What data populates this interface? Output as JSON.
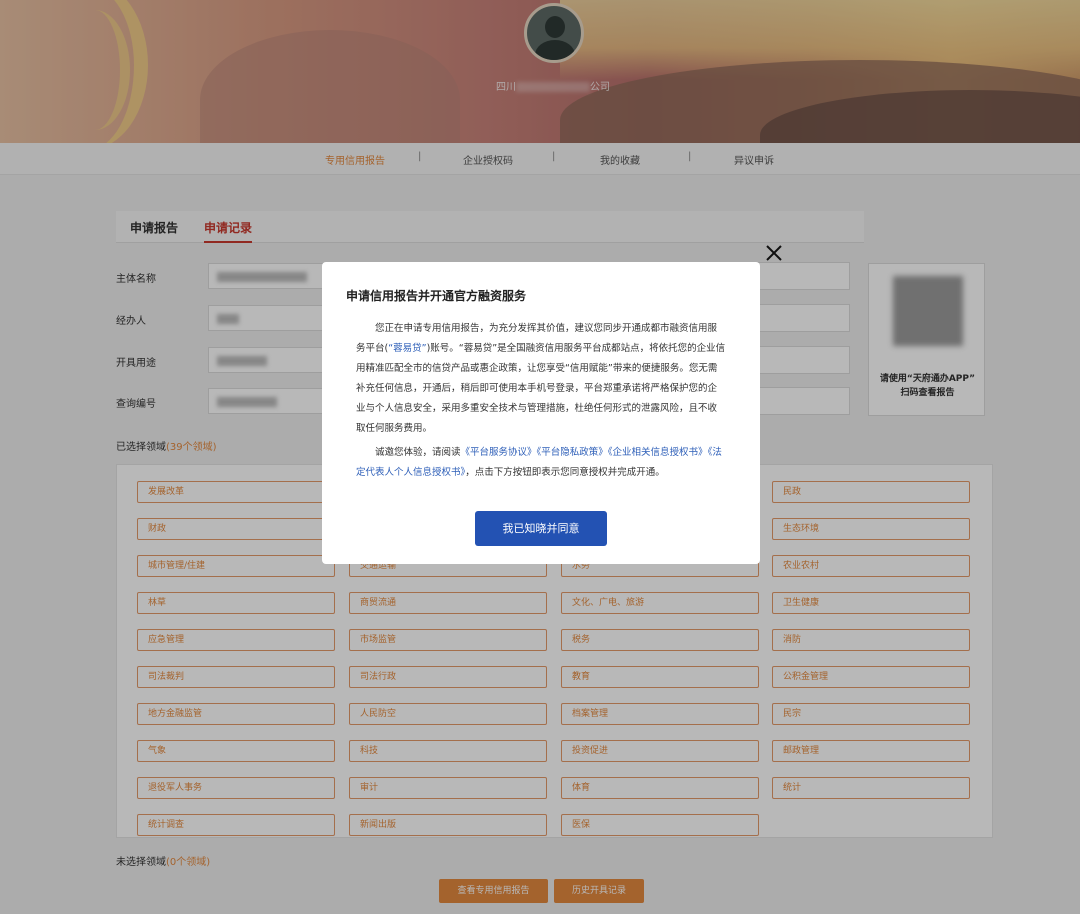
{
  "header": {
    "company_prefix": "四川",
    "company_suffix": "公司"
  },
  "nav": {
    "items": [
      "专用信用报告",
      "企业授权码",
      "我的收藏",
      "异议申诉"
    ],
    "separator": "|"
  },
  "tabs": [
    "申请报告",
    "申请记录"
  ],
  "form": {
    "subject_name": "主体名称",
    "handler": "经办人",
    "purpose": "开具用途",
    "query_no": "查询编号"
  },
  "qr": {
    "caption_line1": "请使用“天府通办APP”",
    "caption_line2": "扫码查看报告"
  },
  "selected": {
    "label": "已选择领域",
    "count": "(39个领域)"
  },
  "fields": [
    "发展改革",
    "",
    "",
    "民政",
    "财政",
    "",
    "",
    "生态环境",
    "城市管理/住建",
    "交通运输",
    "水务",
    "农业农村",
    "林草",
    "商贸流通",
    "文化、广电、旅游",
    "卫生健康",
    "应急管理",
    "市场监管",
    "税务",
    "消防",
    "司法裁判",
    "司法行政",
    "教育",
    "公积金管理",
    "地方金融监管",
    "人民防空",
    "档案管理",
    "民宗",
    "气象",
    "科技",
    "投资促进",
    "邮政管理",
    "退役军人事务",
    "审计",
    "体育",
    "统计",
    "统计调查",
    "新闻出版",
    "医保"
  ],
  "unselected": {
    "label": "未选择领域",
    "count": "(0个领域)"
  },
  "buttons": {
    "view_report": "查看专用信用报告",
    "history": "历史开具记录"
  },
  "modal": {
    "title": "申请信用报告并开通官方融资服务",
    "p1_a": "您正在申请专用信用报告，为充分发挥其价值，建议您同步开通成都市融资信用服务平台(",
    "p1_link": "“蓉易贷”",
    "p1_b": ")账号。“蓉易贷”是全国融资信用服务平台成都站点，将依托您的企业信用精准匹配全市的信贷产品或惠企政策，让您享受“信用赋能”带来的便捷服务。您无需补充任何信息，开通后，稍后即可使用本手机号登录，平台郑重承诺将严格保护您的企业与个人信息安全，采用多重安全技术与管理措施，杜绝任何形式的泄露风险，且不收取任何服务费用。",
    "p2_a": "诚邀您体验，请阅读",
    "link1": "《平台服务协议》",
    "link2": "《平台隐私政策》",
    "link3": "《企业相关信息授权书》",
    "link4": "《法定代表人个人信息授权书》",
    "p2_b": "，点击下方按钮即表示您同意授权并完成开通。",
    "button": "我已知晓并同意"
  },
  "colors": {
    "accent": "#e4893f",
    "modal_button": "#2352b3",
    "link": "#2e5fb8",
    "tab_active": "#c9392e"
  }
}
